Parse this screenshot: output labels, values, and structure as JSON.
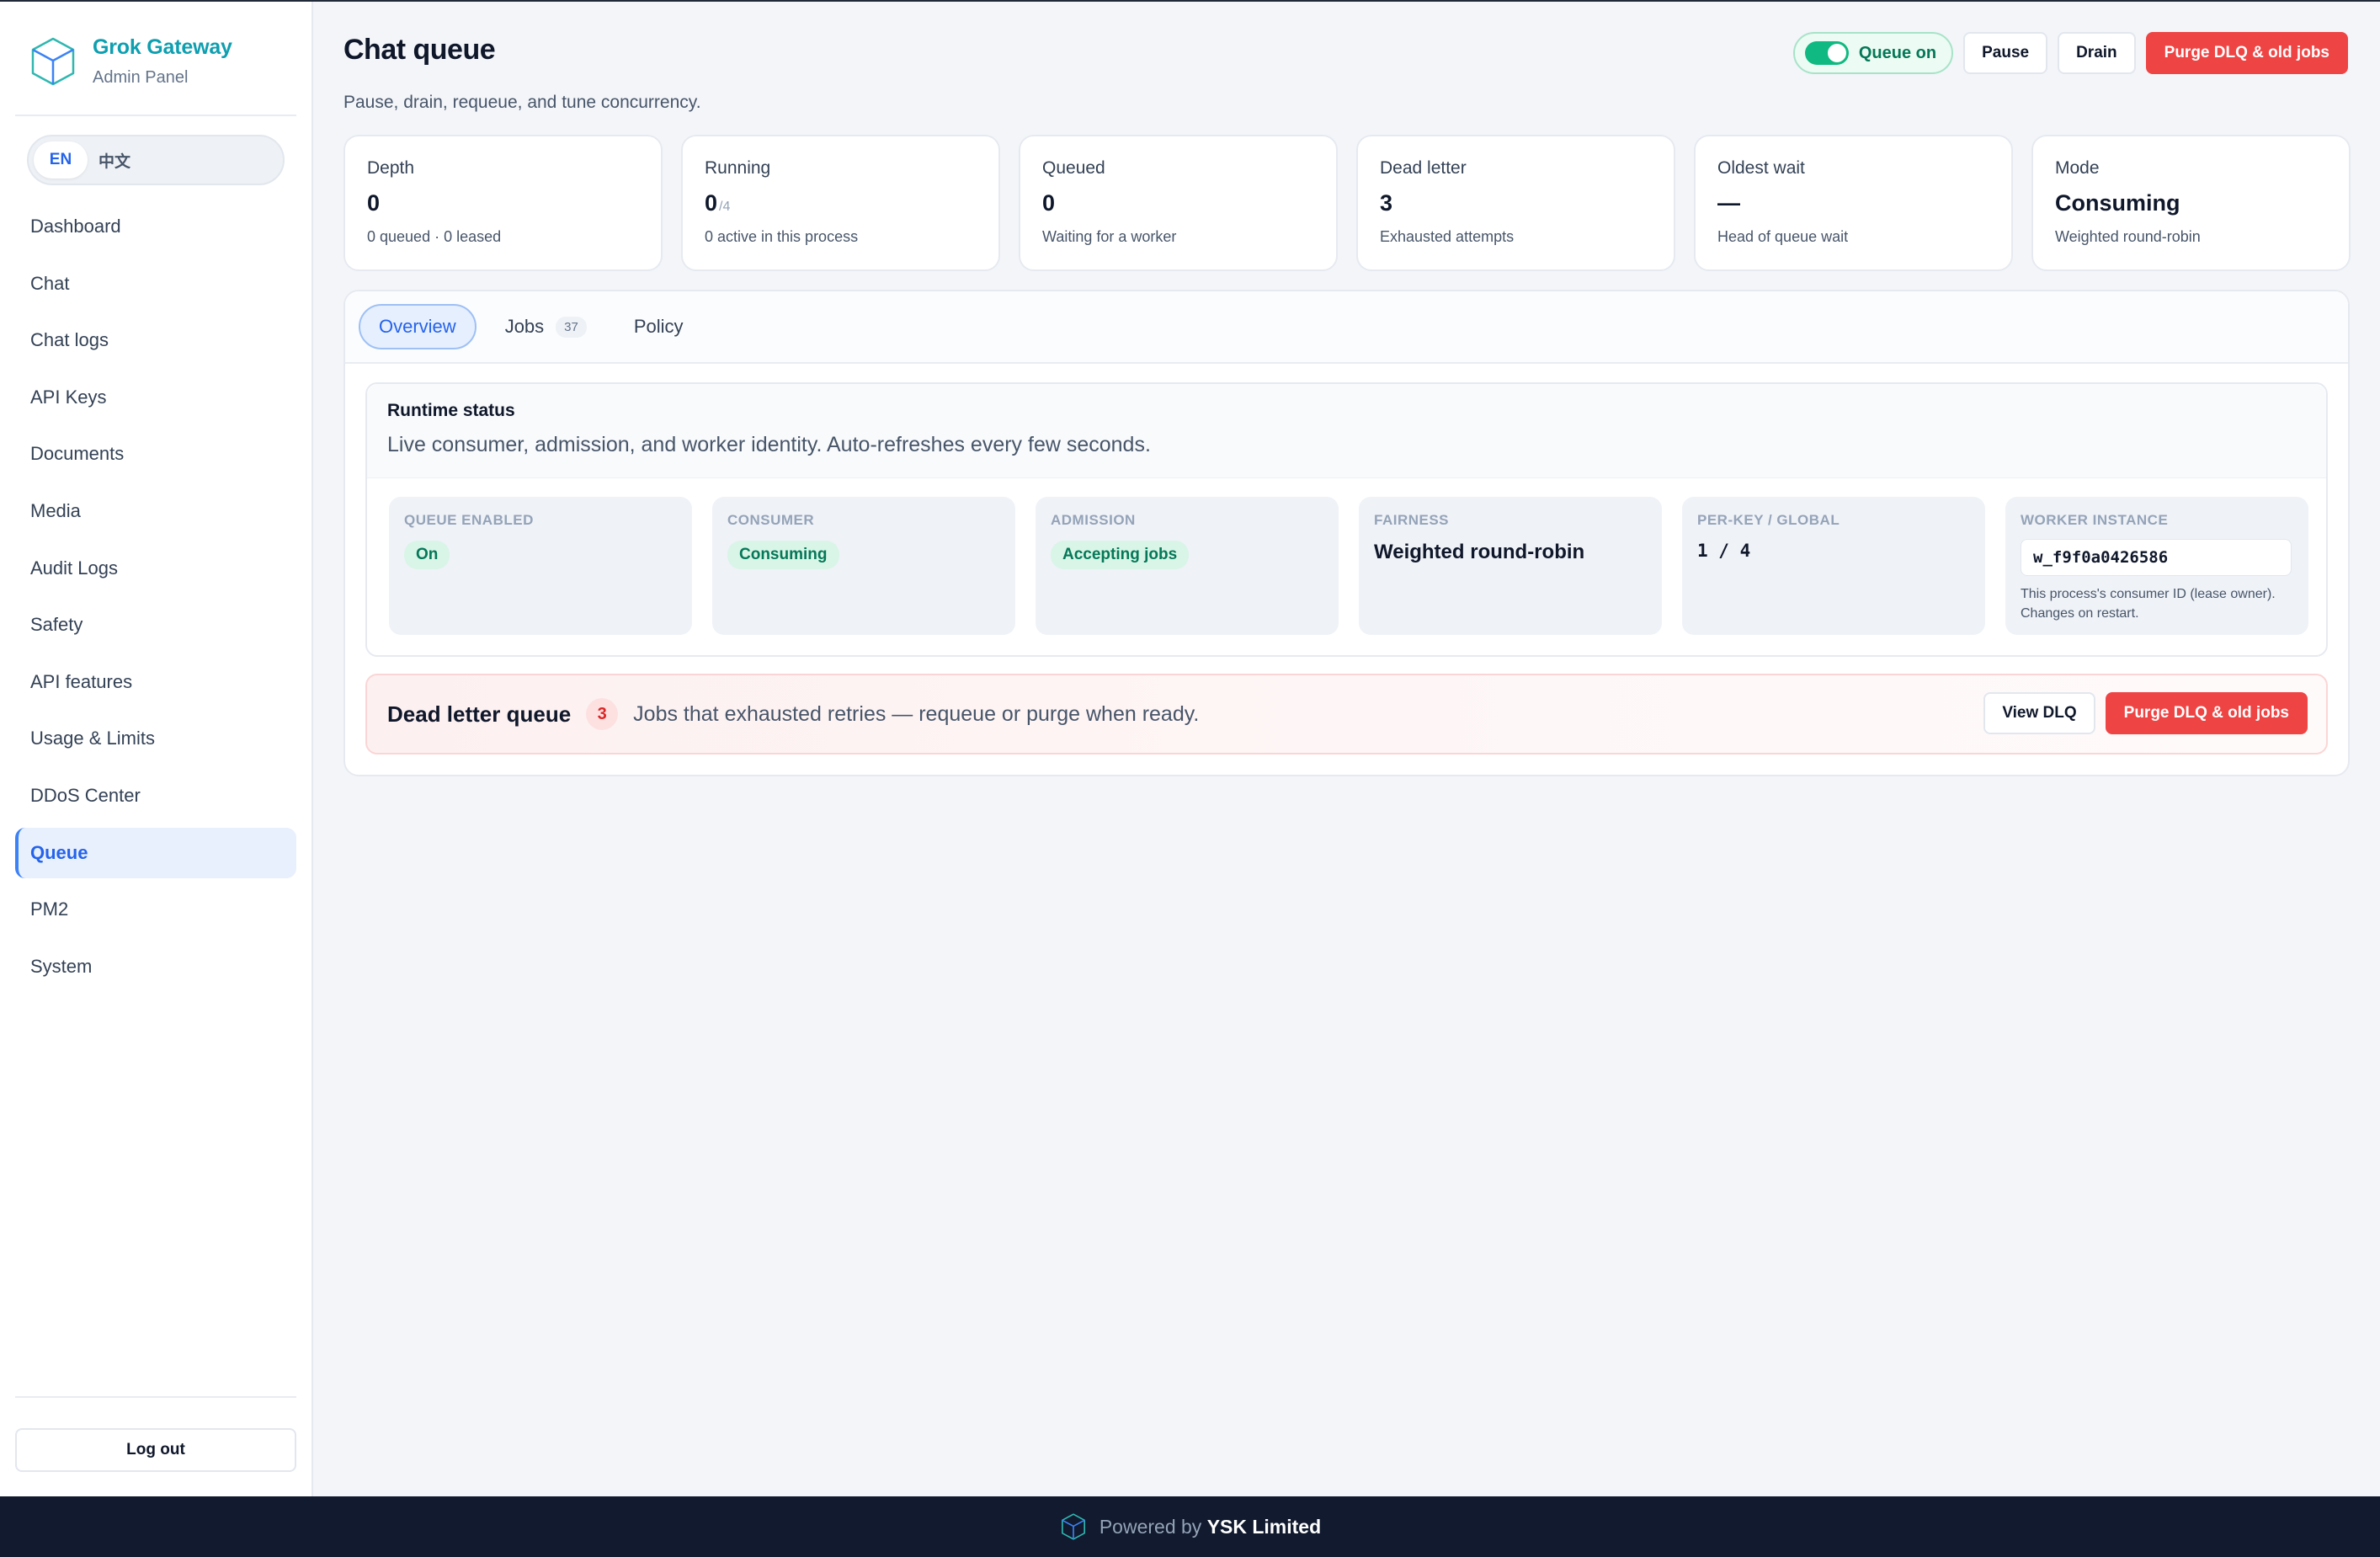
{
  "brand": {
    "title": "Grok Gateway",
    "subtitle": "Admin Panel",
    "logo_icon": "cube-icon",
    "accent": "#0e9fb0"
  },
  "language": {
    "options": [
      "EN",
      "中文"
    ],
    "selected": "EN"
  },
  "sidebar": {
    "items": [
      {
        "label": "Dashboard"
      },
      {
        "label": "Chat"
      },
      {
        "label": "Chat logs"
      },
      {
        "label": "API Keys"
      },
      {
        "label": "Documents"
      },
      {
        "label": "Media"
      },
      {
        "label": "Audit Logs"
      },
      {
        "label": "Safety"
      },
      {
        "label": "API features"
      },
      {
        "label": "Usage & Limits"
      },
      {
        "label": "DDoS Center"
      },
      {
        "label": "Queue",
        "active": true
      },
      {
        "label": "PM2"
      },
      {
        "label": "System"
      }
    ],
    "logout_label": "Log out"
  },
  "header": {
    "title": "Chat queue",
    "subtitle": "Pause, drain, requeue, and tune concurrency.",
    "toggle_label": "Queue on",
    "toggle_on": true,
    "pause_label": "Pause",
    "drain_label": "Drain",
    "purge_label": "Purge DLQ & old jobs"
  },
  "stats": [
    {
      "label": "Depth",
      "value": "0",
      "suffix": "",
      "sub": "0 queued · 0 leased"
    },
    {
      "label": "Running",
      "value": "0",
      "suffix": "/4",
      "sub": "0 active in this process"
    },
    {
      "label": "Queued",
      "value": "0",
      "suffix": "",
      "sub": "Waiting for a worker"
    },
    {
      "label": "Dead letter",
      "value": "3",
      "suffix": "",
      "sub": "Exhausted attempts"
    },
    {
      "label": "Oldest wait",
      "value": "—",
      "suffix": "",
      "sub": "Head of queue wait"
    },
    {
      "label": "Mode",
      "value": "Consuming",
      "suffix": "",
      "sub": "Weighted round-robin"
    }
  ],
  "tabs": [
    {
      "label": "Overview",
      "active": true
    },
    {
      "label": "Jobs",
      "badge": "37"
    },
    {
      "label": "Policy"
    }
  ],
  "runtime": {
    "title": "Runtime status",
    "description": "Live consumer, admission, and worker identity. Auto-refreshes every few seconds.",
    "queue_enabled": {
      "label": "QUEUE ENABLED",
      "value": "On"
    },
    "consumer": {
      "label": "CONSUMER",
      "value": "Consuming"
    },
    "admission": {
      "label": "ADMISSION",
      "value": "Accepting jobs"
    },
    "fairness": {
      "label": "FAIRNESS",
      "value": "Weighted round-robin"
    },
    "per_key": {
      "label": "PER-KEY / GLOBAL",
      "value": "1 / 4"
    },
    "worker": {
      "label": "WORKER INSTANCE",
      "value": "w_f9f0a0426586",
      "note": "This process's consumer ID (lease owner). Changes on restart."
    }
  },
  "dlq": {
    "title": "Dead letter queue",
    "count": "3",
    "description": "Jobs that exhausted retries — requeue or purge when ready.",
    "view_label": "View DLQ",
    "purge_label": "Purge DLQ & old jobs"
  },
  "footer": {
    "prefix": "Powered by",
    "company": "YSK Limited",
    "icon": "cube-icon"
  },
  "colors": {
    "primary": "#2563eb",
    "danger": "#ef4444",
    "success": "#10b981",
    "footer_bg": "#111a2e"
  }
}
